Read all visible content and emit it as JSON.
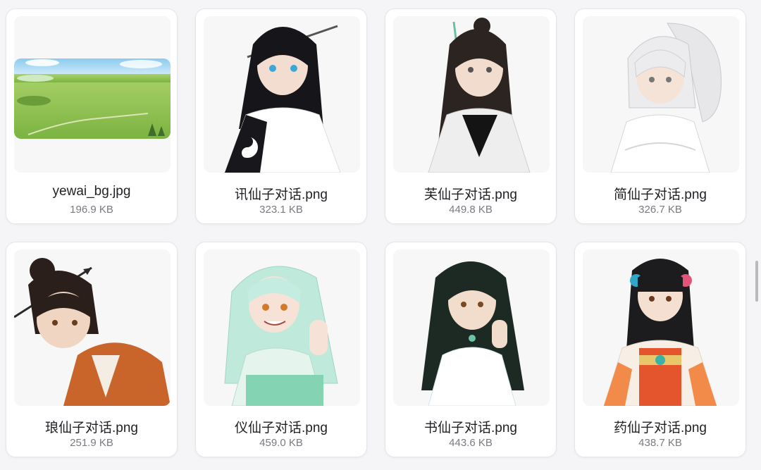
{
  "files": [
    {
      "name": "yewai_bg.jpg",
      "size": "196.9 KB",
      "preview": "landscape"
    },
    {
      "name": "讯仙子对话.png",
      "size": "323.1 KB",
      "preview": "portrait-black-robe"
    },
    {
      "name": "芙仙子对话.png",
      "size": "449.8 KB",
      "preview": "portrait-white-black-robe"
    },
    {
      "name": "简仙子对话.png",
      "size": "326.7 KB",
      "preview": "portrait-white-hair"
    },
    {
      "name": "琅仙子对话.png",
      "size": "251.9 KB",
      "preview": "portrait-orange-robe"
    },
    {
      "name": "仪仙子对话.png",
      "size": "459.0 KB",
      "preview": "portrait-mint-hair"
    },
    {
      "name": "书仙子对话.png",
      "size": "443.6 KB",
      "preview": "portrait-dark-hair-white-robe"
    },
    {
      "name": "药仙子对话.png",
      "size": "438.7 KB",
      "preview": "portrait-red-dress"
    }
  ],
  "colors": {
    "card_bg": "#ffffff",
    "page_bg": "#f5f5f7",
    "name_text": "#222226",
    "size_text": "#7a7a80"
  }
}
